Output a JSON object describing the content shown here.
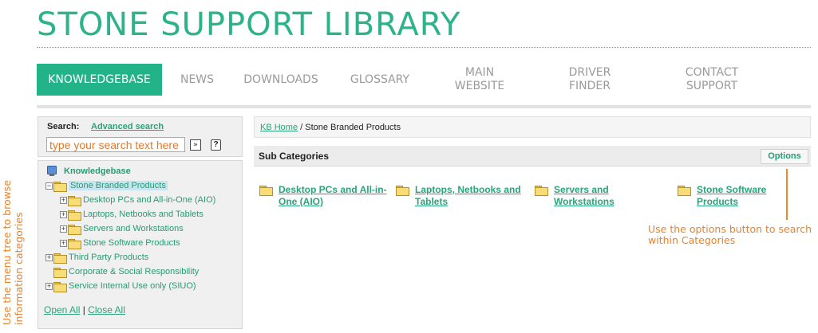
{
  "site": {
    "title": "STONE SUPPORT LIBRARY"
  },
  "nav": {
    "items": [
      {
        "label": "KNOWLEDGEBASE",
        "active": true
      },
      {
        "label": "NEWS"
      },
      {
        "label": "DOWNLOADS"
      },
      {
        "label": "GLOSSARY"
      },
      {
        "label": "MAIN\nWEBSITE"
      },
      {
        "label": "DRIVER\nFINDER"
      },
      {
        "label": "CONTACT\nSUPPORT"
      }
    ]
  },
  "search": {
    "label": "Search:",
    "advanced_label": "Advanced search",
    "placeholder": "type your search text here",
    "go_label": "»",
    "help_label": "?"
  },
  "tree": {
    "root_label": "Knowledgebase",
    "items": [
      {
        "label": "Stone Branded Products",
        "expander": "−",
        "selected": true
      },
      {
        "label": "Desktop PCs and All-in-One (AIO)",
        "expander": "+"
      },
      {
        "label": "Laptops, Netbooks and Tablets",
        "expander": "+"
      },
      {
        "label": "Servers and Workstations",
        "expander": "+"
      },
      {
        "label": "Stone Software Products",
        "expander": "+"
      },
      {
        "label": "Third Party Products",
        "expander": "+"
      },
      {
        "label": "Corporate & Social Responsibility",
        "expander": ""
      },
      {
        "label": "Service Internal Use only (SIUO)",
        "expander": "+"
      }
    ],
    "open_all": "Open All",
    "separator": "|",
    "close_all": "Close All"
  },
  "breadcrumb": {
    "home": "KB Home",
    "separator": " / ",
    "current": "Stone Branded Products"
  },
  "subcategories": {
    "title": "Sub Categories",
    "options_label": "Options",
    "items": [
      {
        "label": "Desktop PCs and All-in-\nOne (AIO)"
      },
      {
        "label": "Laptops, Netbooks and\nTablets"
      },
      {
        "label": "Servers and\nWorkstations"
      },
      {
        "label": "Stone Software\nProducts"
      }
    ]
  },
  "annotations": {
    "options_hint": "Use the options button to search within Categories",
    "tree_hint": "Use the menu tree to browse information categories"
  },
  "colors": {
    "brand": "#2db38a",
    "accent_orange": "#e8822a",
    "link": "#2ba37c"
  }
}
